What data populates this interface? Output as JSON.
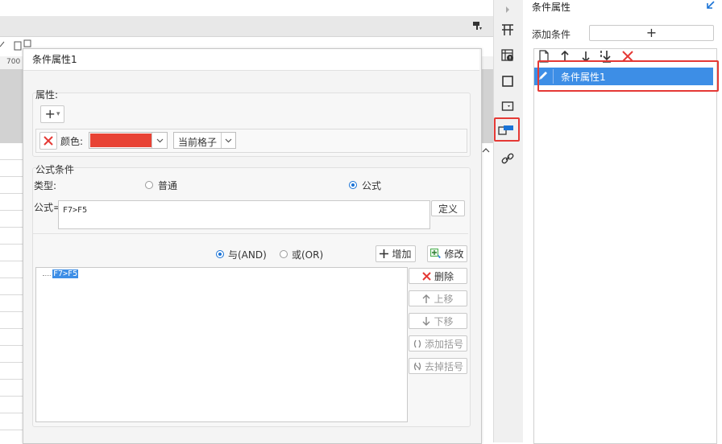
{
  "background": {
    "ruler_number": "700"
  },
  "dialog": {
    "title": "条件属性1",
    "properties": {
      "label": "属性:",
      "add_symbol": "+",
      "add_dropdown": "▾",
      "remove_symbol": "✕",
      "color_label": "颜色:",
      "color_value": "#e84335",
      "dropdown_symbol": "⌵",
      "scope_value": "当前格子"
    },
    "formula": {
      "group_label": "公式条件",
      "type_label": "类型:",
      "type_option_normal": "普通",
      "type_option_formula": "公式",
      "formula_label": "公式=",
      "formula_value": "F7>F5",
      "define_button": "定义",
      "and_label": "与(AND)",
      "or_label": "或(OR)",
      "add_button": "增加",
      "modify_button": "修改",
      "tree_item": "F7>F5",
      "delete_button": "删除",
      "move_up_button": "上移",
      "move_down_button": "下移",
      "add_bracket_button": "添加括号",
      "remove_bracket_button": "去掉括号"
    }
  },
  "panel": {
    "title": "条件属性",
    "add_condition_label": "添加条件",
    "add_condition_symbol": "+",
    "list_items": [
      "条件属性1"
    ]
  },
  "colors": {
    "accent": "#1a73d6",
    "selection": "#3d8ee6",
    "highlight_frame": "#e53935",
    "delete_red": "#e53935"
  }
}
